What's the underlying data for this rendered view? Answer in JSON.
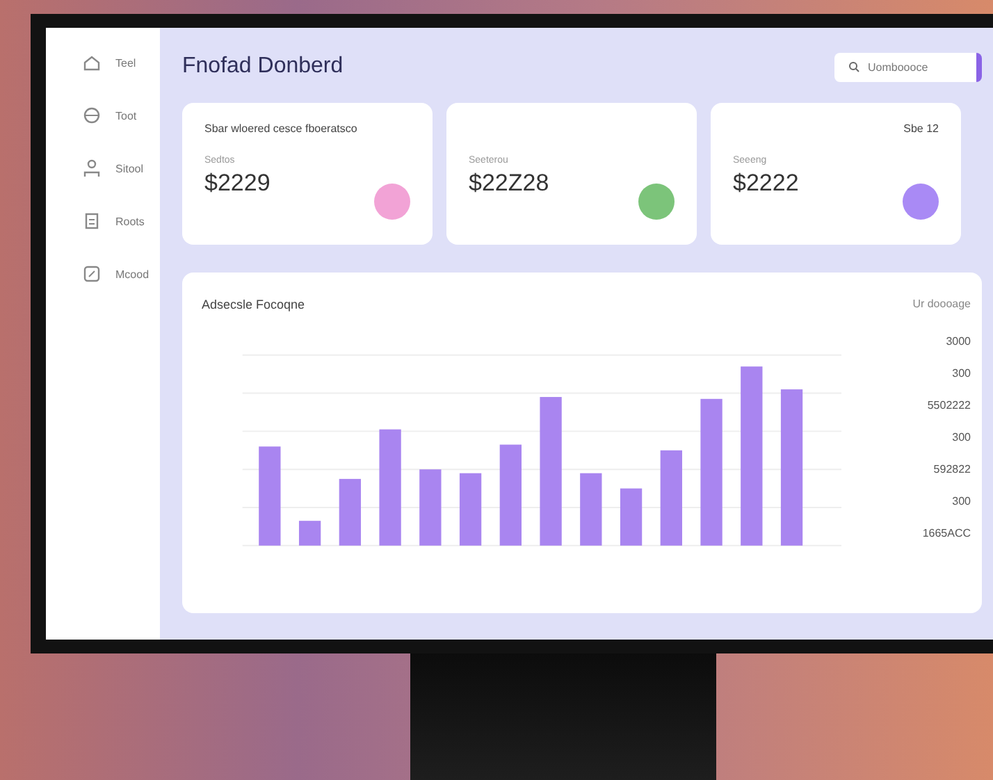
{
  "sidebar": {
    "items": [
      {
        "label": "Teel"
      },
      {
        "label": "Toot"
      },
      {
        "label": "Sitool"
      },
      {
        "label": "Roots"
      },
      {
        "label": "Mcood"
      }
    ]
  },
  "header": {
    "title": "Fnofad Donberd",
    "search": {
      "placeholder": "Uomboooce"
    }
  },
  "cards": [
    {
      "caption": "Sbar wloered cesce fboeratsco",
      "label": "Sedtos",
      "value": "$2229",
      "color": "#f2a3d6"
    },
    {
      "label": "Seeterou",
      "value": "$22Z28",
      "color": "#7cc47a"
    },
    {
      "caption": "Sbe 12",
      "label": "Seeeng",
      "value": "$2222",
      "color": "#a98af5"
    }
  ],
  "chart_panel": {
    "title": "Adsecsle Focoqne",
    "legend": "Ur doooage",
    "figures": [
      "3000",
      "300",
      "5502222",
      "300",
      "592822",
      "300",
      "1665ACC"
    ]
  }
}
